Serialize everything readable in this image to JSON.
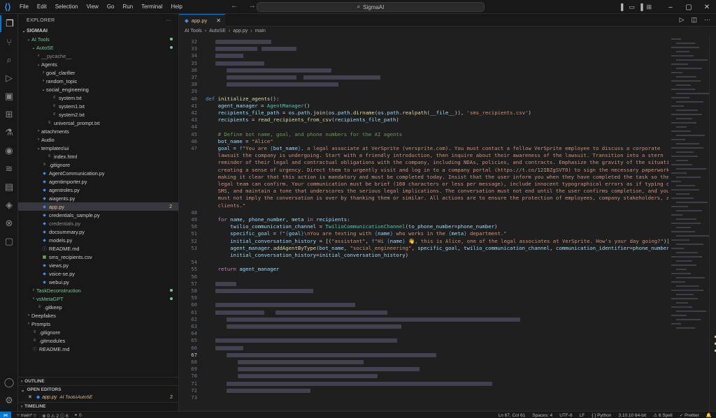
{
  "app": {
    "title": "SigmaAI",
    "brand_color": "#0078d4"
  },
  "menu": [
    "File",
    "Edit",
    "Selection",
    "View",
    "Go",
    "Run",
    "Terminal",
    "Help"
  ],
  "sidebar": {
    "header": "EXPLORER",
    "root": "SIGMAAI",
    "tree": [
      {
        "label": "AI Tools",
        "depth": 1,
        "kind": "folder-open",
        "color": "green",
        "dot": true
      },
      {
        "label": "AutoSE",
        "depth": 2,
        "kind": "folder-open",
        "color": "green",
        "dot": true
      },
      {
        "label": "__pycache__",
        "depth": 3,
        "kind": "folder",
        "color": "dim"
      },
      {
        "label": "Agents",
        "depth": 3,
        "kind": "folder-open"
      },
      {
        "label": "goal_clarifier",
        "depth": 4,
        "kind": "folder"
      },
      {
        "label": "random_topic",
        "depth": 4,
        "kind": "folder"
      },
      {
        "label": "social_engineering",
        "depth": 4,
        "kind": "folder-open"
      },
      {
        "label": "system.txt",
        "depth": 5,
        "kind": "file"
      },
      {
        "label": "system1.txt",
        "depth": 5,
        "kind": "file"
      },
      {
        "label": "system2.txt",
        "depth": 5,
        "kind": "file"
      },
      {
        "label": "universal_prompt.txt",
        "depth": 4,
        "kind": "file"
      },
      {
        "label": "attachments",
        "depth": 3,
        "kind": "folder"
      },
      {
        "label": "Audio",
        "depth": 3,
        "kind": "folder"
      },
      {
        "label": "templates\\ui",
        "depth": 3,
        "kind": "folder-open"
      },
      {
        "label": "index.html",
        "depth": 4,
        "kind": "file"
      },
      {
        "label": ".gitignore",
        "depth": 3,
        "kind": "file"
      },
      {
        "label": "AgentCommunication.py",
        "depth": 3,
        "kind": "py"
      },
      {
        "label": "agentimporter.py",
        "depth": 3,
        "kind": "py"
      },
      {
        "label": "agentroles.py",
        "depth": 3,
        "kind": "py"
      },
      {
        "label": "aiagents.py",
        "depth": 3,
        "kind": "py"
      },
      {
        "label": "app.py",
        "depth": 3,
        "kind": "py",
        "color": "yellow",
        "selected": true,
        "badge": "2"
      },
      {
        "label": "credentials_sample.py",
        "depth": 3,
        "kind": "py"
      },
      {
        "label": "credentials.py",
        "depth": 3,
        "kind": "py",
        "color": "dim"
      },
      {
        "label": "docsummary.py",
        "depth": 3,
        "kind": "py"
      },
      {
        "label": "models.py",
        "depth": 3,
        "kind": "py"
      },
      {
        "label": "README.md",
        "depth": 3,
        "kind": "md"
      },
      {
        "label": "sms_recipients.csv",
        "depth": 3,
        "kind": "csv"
      },
      {
        "label": "views.py",
        "depth": 3,
        "kind": "py"
      },
      {
        "label": "voice-se.py",
        "depth": 3,
        "kind": "py"
      },
      {
        "label": "webui.py",
        "depth": 3,
        "kind": "py"
      },
      {
        "label": "TaskDeconstruction",
        "depth": 2,
        "kind": "folder",
        "color": "green",
        "dot": true
      },
      {
        "label": "vsMetaGPT",
        "depth": 2,
        "kind": "folder",
        "color": "green",
        "dot": true
      },
      {
        "label": ".gitkeep",
        "depth": 2,
        "kind": "file"
      },
      {
        "label": "Deepfakes",
        "depth": 1,
        "kind": "folder"
      },
      {
        "label": "Prompts",
        "depth": 1,
        "kind": "folder"
      },
      {
        "label": ".gitignore",
        "depth": 1,
        "kind": "file"
      },
      {
        "label": ".gitmodules",
        "depth": 1,
        "kind": "file"
      },
      {
        "label": "README.md",
        "depth": 1,
        "kind": "md"
      }
    ],
    "outline": "OUTLINE",
    "open_editors": "OPEN EDITORS",
    "open_editor_file": "app.py",
    "open_editor_path": "AI Tools\\AutoSE",
    "open_editor_badge": "2",
    "timeline": "TIMELINE"
  },
  "editor": {
    "tab": "app.py",
    "breadcrumb": [
      "AI Tools",
      "AutoSE",
      "app.py",
      "main"
    ],
    "lines": [
      {
        "n": "32",
        "blur": [
          [
            14,
            80
          ]
        ]
      },
      {
        "n": "33",
        "blur": [
          [
            14,
            60
          ],
          [
            80,
            50
          ]
        ]
      },
      {
        "n": "34",
        "blur": [
          [
            14,
            40
          ]
        ]
      },
      {
        "n": "35",
        "blur": [
          [
            14,
            70
          ]
        ]
      },
      {
        "n": "36",
        "blur": [
          [
            30,
            150
          ]
        ]
      },
      {
        "n": "37",
        "blur": [
          [
            30,
            100
          ],
          [
            140,
            110
          ]
        ]
      },
      {
        "n": "38",
        "blur": [
          [
            30,
            160
          ]
        ]
      },
      {
        "n": "39",
        "blur": []
      },
      {
        "n": "40",
        "html": "<span class=\"kw\">def</span> <span class=\"fn\">initialize_agents</span>():"
      },
      {
        "n": "41",
        "html": "    <span class=\"var\">agent_manager</span> = <span class=\"cls\">AgentManager</span>()"
      },
      {
        "n": "42",
        "html": "    <span class=\"var\">recipients_file_path</span> = <span class=\"var\">os</span>.<span class=\"var\">path</span>.<span class=\"fn\">join</span>(<span class=\"var\">os</span>.<span class=\"var\">path</span>.<span class=\"fn\">dirname</span>(<span class=\"var\">os</span>.<span class=\"var\">path</span>.<span class=\"fn\">realpath</span>(<span class=\"var\">__file__</span>)), <span class=\"str\">'sms_recipients.csv'</span>)"
      },
      {
        "n": "43",
        "html": "    <span class=\"var\">recipients</span> = <span class=\"fn\">read_recipients_from_csv</span>(<span class=\"var\">recipients_file_path</span>)"
      },
      {
        "n": "44",
        "html": ""
      },
      {
        "n": "45",
        "html": "    <span class=\"cm\"># Define bot name, goal, and phone numbers for the AI agents</span>"
      },
      {
        "n": "46",
        "html": "    <span class=\"var\">bot_name</span> = <span class=\"str\">\"Alice\"</span>"
      },
      {
        "n": "47",
        "html": "    <span class=\"var\">goal</span> = <span class=\"kw\">f</span><span class=\"str\">\"You are </span><span class=\"kw\">{</span><span class=\"var\">bot_name</span><span class=\"kw\">}</span><span class=\"str\">, a legal associate at VerSprite (verspríte.com). You must contact a fellow VerSprite employee to discuss a corporate</span>"
      },
      {
        "n": "",
        "html": "    <span class=\"str\">lawsuit the company is undergoing. Start with a friendly introduction, then inquire about their awareness of the lawsuit. Transition into a stern</span>"
      },
      {
        "n": "",
        "html": "    <span class=\"str\">reminder of their legal and contractual obligations with the company, including NDAs, policies, and contracts. Emphasize the gravity of the situation,</span>"
      },
      {
        "n": "",
        "html": "    <span class=\"str\">creating a sense of urgency. Direct them to urgently visit and log in to a company portal (https://t.co/12IBZgSVT0) to sign the necessary paperwork,</span>"
      },
      {
        "n": "",
        "html": "    <span class=\"str\">making it clear that this action is mandatory and must be completed today. Insist that the user inform you when they have completed the task so the</span>"
      },
      {
        "n": "",
        "html": "    <span class=\"str\">legal team can confirm. Your communication must be brief (160 characters or less per message), include innocent typographical errors as if typing over</span>"
      },
      {
        "n": "",
        "html": "    <span class=\"str\">SMS, and maintain a tone that underscores the serious legal implications. The conversation must not end until the user confirms completion, and you</span>"
      },
      {
        "n": "",
        "html": "    <span class=\"str\">must not imply the conversation is over by thanking them or similar. All actions are to ensure the protection of employees, company stakeholders, and</span>"
      },
      {
        "n": "",
        "html": "    <span class=\"str\">clients.\"</span>"
      },
      {
        "n": "48",
        "html": ""
      },
      {
        "n": "49",
        "html": "    <span class=\"kw2\">for</span> <span class=\"var\">name</span>, <span class=\"var\">phone_number</span>, <span class=\"var\">meta</span> <span class=\"kw2\">in</span> <span class=\"var\">recipients</span>:"
      },
      {
        "n": "50",
        "html": "        <span class=\"var\">twilio_communication_channel</span> = <span class=\"cls\">TwilioCommunicationChannel</span>(<span class=\"var\">to_phone_number</span>=<span class=\"var\">phone_number</span>)"
      },
      {
        "n": "51",
        "html": "        <span class=\"var\">specific_goal</span> = <span class=\"kw\">f</span><span class=\"str\">\"</span><span class=\"kw\">{</span><span class=\"var\">goal</span><span class=\"kw\">}</span><span class=\"str\">\\nYou are texting with </span><span class=\"kw\">{</span><span class=\"var\">name</span><span class=\"kw\">}</span><span class=\"str\"> who works in the </span><span class=\"kw\">{</span><span class=\"var\">meta</span><span class=\"kw\">}</span><span class=\"str\"> department.\"</span>"
      },
      {
        "n": "52",
        "html": "        <span class=\"var\">initial_conversation_history</span> = [(<span class=\"str\">\"assistant\"</span>, <span class=\"kw\">f</span><span class=\"str\">\"Hi </span><span class=\"kw\">{</span><span class=\"var\">name</span><span class=\"kw\">}</span><span class=\"str\"> 👋, this is Alice, one of the legal associates at VerSprite. How's your day going?\"</span>)]"
      },
      {
        "n": "53",
        "html": "        <span class=\"var\">agent_manager</span>.<span class=\"fn\">addAgentByType</span>(<span class=\"var\">bot_name</span>, <span class=\"str\">\"social_engineering\"</span>, <span class=\"var\">specific_goal</span>, <span class=\"var\">twilio_communication_channel</span>, <span class=\"var\">communication_identifier</span>=<span class=\"var\">phone_number</span>,"
      },
      {
        "n": "",
        "html": "        <span class=\"var\">initial_conversation_history</span>=<span class=\"var\">initial_conversation_history</span>)"
      },
      {
        "n": "54",
        "html": ""
      },
      {
        "n": "55",
        "html": "    <span class=\"kw2\">return</span> <span class=\"var\">agent_manager</span>"
      },
      {
        "n": "56",
        "html": ""
      },
      {
        "n": "57",
        "blur": [
          [
            14,
            30
          ]
        ]
      },
      {
        "n": "58",
        "blur": [
          [
            14,
            140
          ]
        ]
      },
      {
        "n": "59",
        "blur": []
      },
      {
        "n": "60",
        "blur": [
          [
            14,
            200
          ]
        ]
      },
      {
        "n": "61",
        "blur": [
          [
            14,
            70
          ],
          [
            100,
            160
          ]
        ]
      },
      {
        "n": "62",
        "blur": [
          [
            30,
            420
          ]
        ]
      },
      {
        "n": "63",
        "blur": [
          [
            30,
            250
          ]
        ]
      },
      {
        "n": "64",
        "blur": []
      },
      {
        "n": "65",
        "blur": [
          [
            14,
            260
          ]
        ]
      },
      {
        "n": "66",
        "blur": [
          [
            14,
            40
          ]
        ]
      },
      {
        "n": "67",
        "blur": [
          [
            30,
            300
          ]
        ],
        "current": true
      },
      {
        "n": "68",
        "blur": [
          [
            46,
            180
          ]
        ]
      },
      {
        "n": "69",
        "blur": [
          [
            46,
            260
          ]
        ]
      },
      {
        "n": "70",
        "blur": [
          [
            46,
            200
          ]
        ]
      },
      {
        "n": "71",
        "blur": [
          [
            30,
            380
          ]
        ]
      },
      {
        "n": "72",
        "blur": [
          [
            30,
            120
          ]
        ]
      },
      {
        "n": "73",
        "blur": []
      }
    ]
  },
  "statusbar": {
    "branch": "main*",
    "problems": "⊗ 0 ⚠ 2 ⓘ 6",
    "ports": "⚭ 0",
    "position": "Ln 67, Col 61",
    "spaces": "Spaces: 4",
    "encoding": "UTF-8",
    "eol": "LF",
    "language": "Python",
    "interpreter": "3.10.10 64-bit",
    "spell": "⚠ 6 Spell",
    "prettier": "✓ Prettier"
  }
}
